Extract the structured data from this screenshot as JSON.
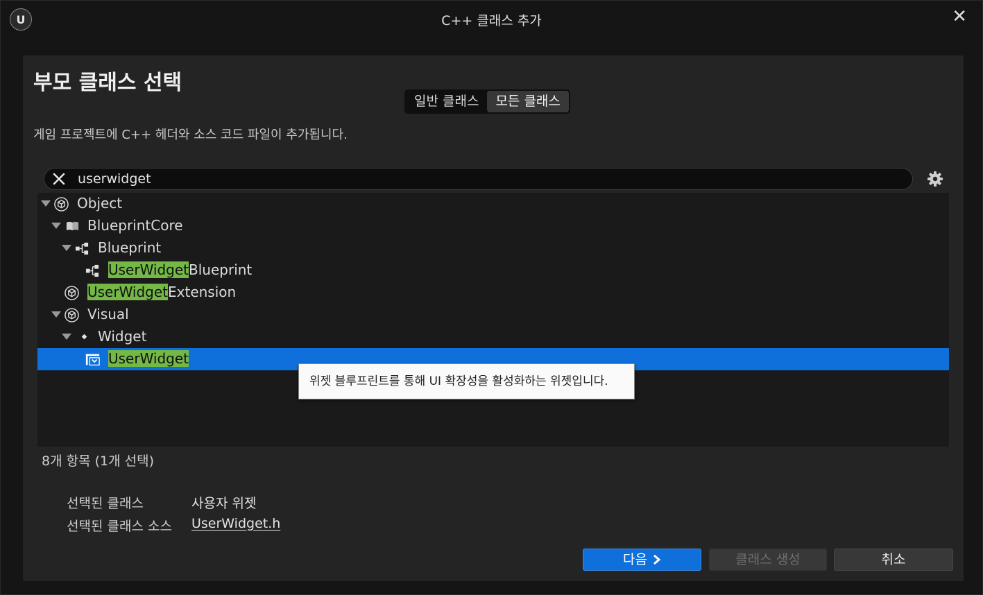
{
  "window": {
    "logo_text": "U",
    "title": "C++ 클래스 추가",
    "close_glyph": "✕"
  },
  "heading": "부모 클래스 선택",
  "toggle": {
    "common_label": "일반 클래스",
    "all_label": "모든 클래스",
    "selected": "모든 클래스"
  },
  "description": "게임 프로젝트에 C++ 헤더와 소스 코드 파일이 추가됩니다.",
  "search": {
    "value": "userwidget",
    "clear_icon": "close-icon",
    "settings_icon": "gear-icon"
  },
  "tree": [
    {
      "prefix": "",
      "highlight": "",
      "suffix": "Object",
      "icon": "object-cube-icon",
      "expanded": true
    },
    {
      "prefix": "",
      "highlight": "",
      "suffix": "BlueprintCore",
      "icon": "book-icon",
      "expanded": true
    },
    {
      "prefix": "",
      "highlight": "",
      "suffix": "Blueprint",
      "icon": "blueprint-node-icon",
      "expanded": true
    },
    {
      "prefix": "",
      "highlight": "UserWidget",
      "suffix": "Blueprint",
      "icon": "blueprint-node-icon",
      "expanded": false
    },
    {
      "prefix": "",
      "highlight": "UserWidget",
      "suffix": "Extension",
      "icon": "object-cube-icon",
      "expanded": false
    },
    {
      "prefix": "",
      "highlight": "",
      "suffix": "Visual",
      "icon": "object-cube-icon",
      "expanded": true
    },
    {
      "prefix": "",
      "highlight": "",
      "suffix": "Widget",
      "icon": "diamond-icon",
      "expanded": true
    },
    {
      "prefix": "",
      "highlight": "UserWidget",
      "suffix": "",
      "icon": "user-widget-icon",
      "expanded": false,
      "selected": true
    }
  ],
  "tooltip": "위젯 블루프린트를 통해 UI 확장성을 활성화하는 위젯입니다.",
  "item_count": "8개 항목 (1개 선택)",
  "selected_class": {
    "label": "선택된 클래스",
    "value": "사용자 위젯"
  },
  "selected_source": {
    "label": "선택된 클래스 소스",
    "value": "UserWidget.h"
  },
  "buttons": {
    "next": "다음",
    "next_icon": "chevron-right-icon",
    "create": "클래스 생성",
    "cancel": "취소"
  },
  "colors": {
    "accent": "#0f70dc",
    "match_highlight": "#74b945",
    "panel": "#242424"
  }
}
